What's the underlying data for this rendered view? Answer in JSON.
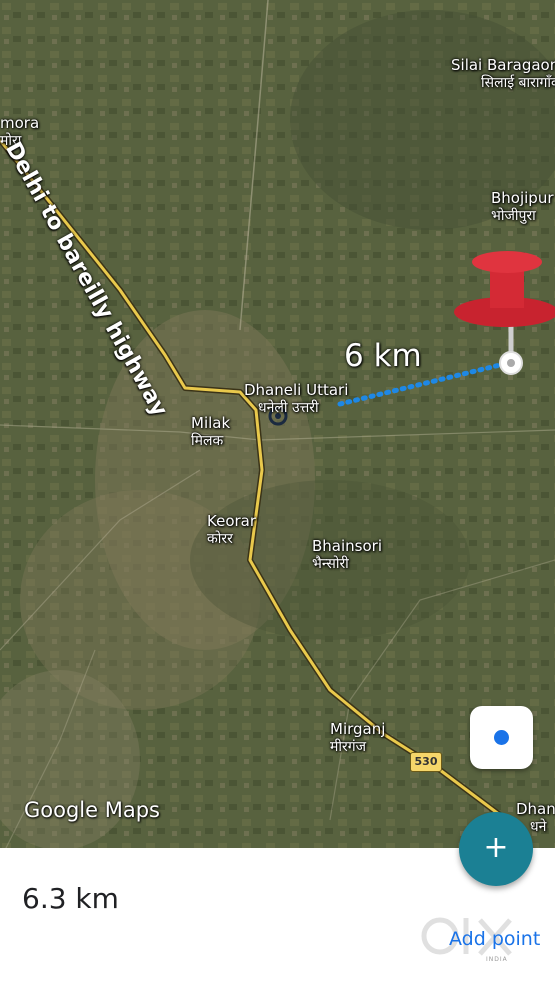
{
  "map": {
    "places": [
      {
        "id": "silai",
        "name": "Silai Baragaon",
        "hindi": "सिलाई बारागाँव"
      },
      {
        "id": "mora",
        "name": "mora",
        "hindi": "मोरा"
      },
      {
        "id": "bhojipur",
        "name": "Bhojipur",
        "hindi": "भोजीपुरा"
      },
      {
        "id": "dhaneli",
        "name": "Dhaneli Uttari",
        "hindi": "धनेली उत्तरी"
      },
      {
        "id": "milak",
        "name": "Milak",
        "hindi": "मिलक"
      },
      {
        "id": "keorar",
        "name": "Keorar",
        "hindi": "कोरर"
      },
      {
        "id": "bhainsori",
        "name": "Bhainsori",
        "hindi": "भैन्सोरी"
      },
      {
        "id": "mirganj",
        "name": "Mirganj",
        "hindi": "मीरगंज"
      },
      {
        "id": "dhan",
        "name": "Dhan",
        "hindi": "धने"
      }
    ],
    "highway_label": "Delhi to bareilly highway",
    "distance_label": "6 km",
    "route_shield": "530",
    "attribution": "Google Maps",
    "colors": {
      "road": "#e9c94c",
      "measure_line": "#1e88e5",
      "pin": "#d42a35"
    }
  },
  "location_button": {
    "icon": "my-location-icon"
  },
  "bottom_sheet": {
    "distance": "6.3 km",
    "fab_icon": "+",
    "add_point_label": "Add point"
  },
  "watermark": {
    "text": "OLX",
    "sub": "INDIA"
  }
}
